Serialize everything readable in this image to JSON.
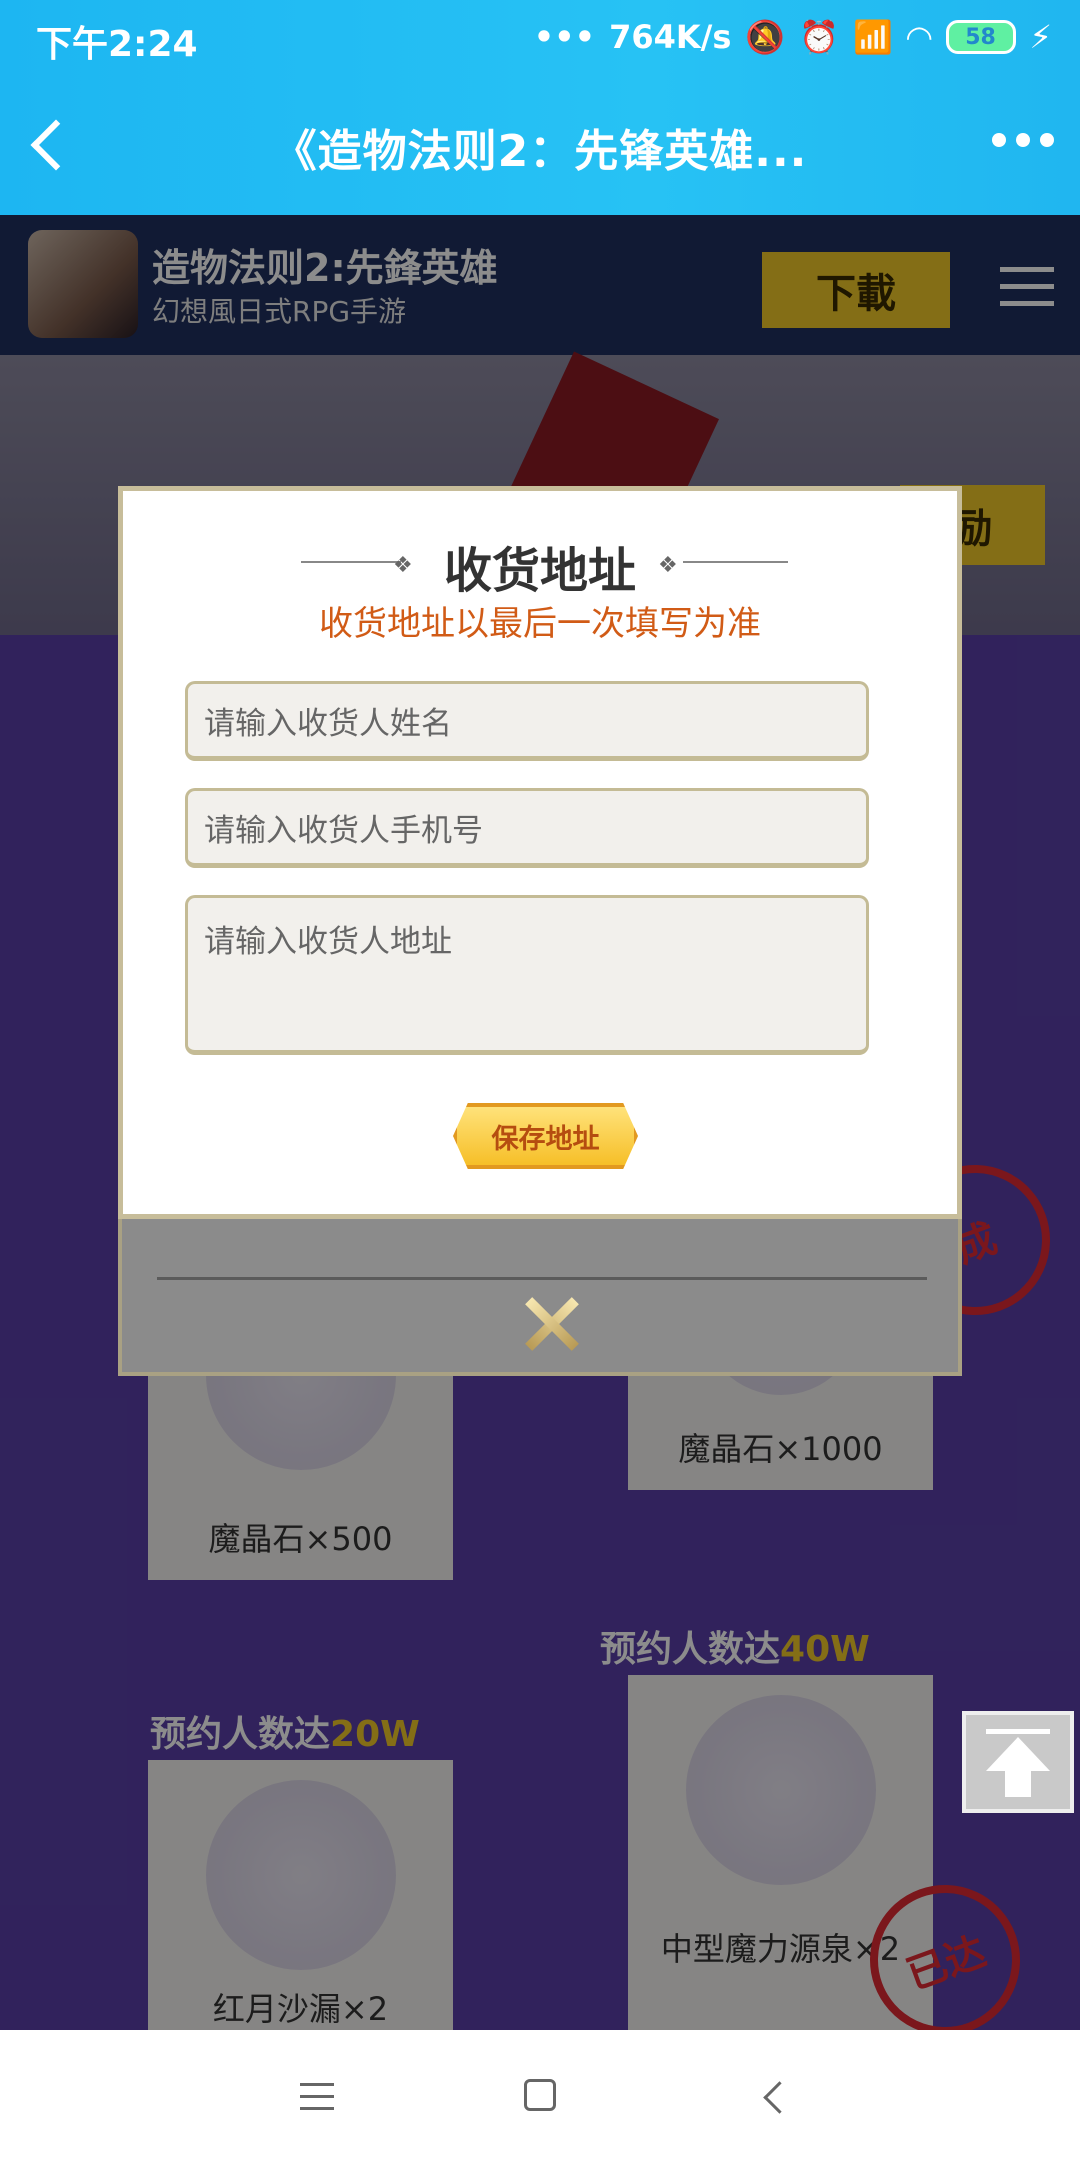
{
  "status_bar": {
    "time": "下午2:24",
    "speed": "764K/s",
    "battery": "58",
    "icons": [
      "signal-dots-icon",
      "mute-icon",
      "alarm-icon",
      "hd-signal-icon",
      "wifi-icon",
      "battery-icon",
      "charging-icon"
    ]
  },
  "navbar": {
    "title": "《造物法则2：先锋英雄...",
    "back_icon": "chevron-left-icon",
    "more_icon": "more-dots-icon"
  },
  "banner": {
    "app_name": "造物法则2:先鋒英雄",
    "app_subtitle": "幻想風日式RPG手游",
    "download_label": "下載",
    "menu_icon": "hamburger-icon"
  },
  "page": {
    "reward_button": "励",
    "cards": [
      {
        "label": "魔晶石×500"
      },
      {
        "label": "魔晶石×1000"
      },
      {
        "label": "红月沙漏×2"
      },
      {
        "label": "中型魔力源泉×2"
      }
    ],
    "tiers": [
      {
        "prefix": "预约人数达",
        "value": "40W"
      },
      {
        "prefix": "预约人数达",
        "value": "20W"
      }
    ],
    "stamps": [
      "成",
      "已达"
    ],
    "scroll_top_icon": "arrow-up-icon"
  },
  "modal": {
    "title": "收货地址",
    "subtitle": "收货地址以最后一次填写为准",
    "name_placeholder": "请输入收货人姓名",
    "phone_placeholder": "请输入收货人手机号",
    "address_placeholder": "请输入收货人地址",
    "save_label": "保存地址",
    "close_icon": "close-x-icon"
  },
  "system_nav": {
    "icons": [
      "recent-apps-icon",
      "home-icon",
      "back-icon"
    ]
  },
  "colors": {
    "header": "#27c2f4",
    "accent_yellow": "#f0c928",
    "subtitle_orange": "#d15b16",
    "page_purple": "#5a3fa8"
  }
}
